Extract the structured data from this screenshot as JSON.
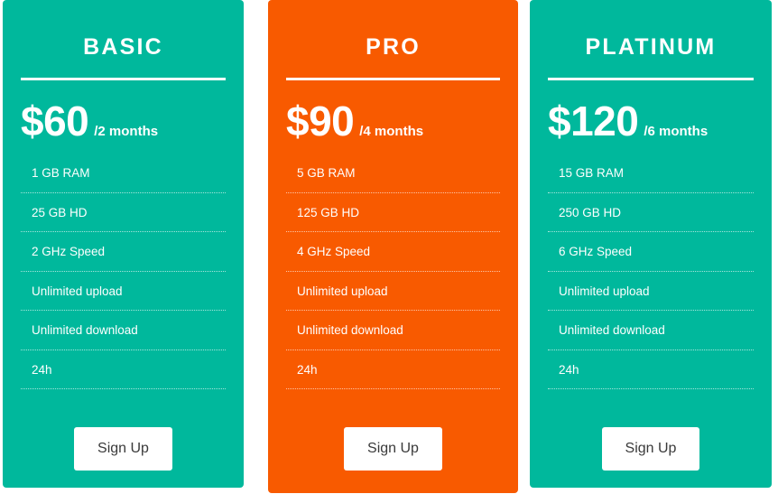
{
  "page": {
    "title": "Pricing Table",
    "background_color": "#ffffff"
  },
  "theme": {
    "teal": "#00b89c",
    "orange": "#f85a00",
    "card_text_color": "#ffffff",
    "button_background": "#ffffff",
    "button_text_color": "#3a3a3a",
    "separator_color": "rgba(255,255,255,0.65)"
  },
  "plans": [
    {
      "id": "basic",
      "name": "BASIC",
      "accent_color": "#00b89c",
      "price": "$60",
      "price_value": 60,
      "currency": "$",
      "period": "/2 months",
      "period_months": 2,
      "features": [
        "1 GB RAM",
        "25 GB HD",
        "2 GHz Speed",
        "Unlimited upload",
        "Unlimited download",
        "24h"
      ],
      "cta_label": "Sign Up"
    },
    {
      "id": "pro",
      "name": "PRO",
      "accent_color": "#f85a00",
      "price": "$90",
      "price_value": 90,
      "currency": "$",
      "period": "/4 months",
      "period_months": 4,
      "features": [
        "5 GB RAM",
        "125 GB HD",
        "4 GHz Speed",
        "Unlimited upload",
        "Unlimited download",
        "24h"
      ],
      "cta_label": "Sign Up"
    },
    {
      "id": "platinum",
      "name": "PLATINUM",
      "accent_color": "#00b89c",
      "price": "$120",
      "price_value": 120,
      "currency": "$",
      "period": "/6 months",
      "period_months": 6,
      "features": [
        "15 GB RAM",
        "250 GB HD",
        "6 GHz Speed",
        "Unlimited upload",
        "Unlimited download",
        "24h"
      ],
      "cta_label": "Sign Up"
    }
  ]
}
